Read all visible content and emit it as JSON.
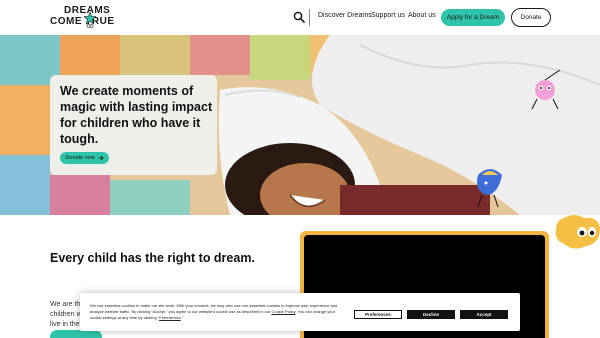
{
  "header": {
    "logo_line1": "DREAMS",
    "logo_line2": "COME TRUE",
    "nav": [
      "Discover Dreams",
      "Support us",
      "About us"
    ],
    "apply_label": "Apply for a Dream",
    "donate_label": "Donate"
  },
  "hero": {
    "heading": "We create moments of magic with lasting impact for children who have it tough.",
    "button_label": "Donate now"
  },
  "section": {
    "title": "Every child has the right to dream.",
    "text_lines": [
      "We are the",
      "children wi",
      "live in the h"
    ]
  },
  "cookie": {
    "text_before_policy": "We use essential cookies to make our site work. With your consent, we may also use non-essential cookies to improve user experience and analyze website traffic. By clicking “Accept,” you agree to our website's cookie use as described in our ",
    "policy_link": "Cookie Policy",
    "text_after_policy": ". You can change your cookie settings at any time by clicking “",
    "preferences_link": "Preferences",
    "text_end": ".”",
    "preferences_label": "Preferences",
    "decline_label": "Decline",
    "accept_label": "Accept"
  },
  "colors": {
    "accent": "#2ec4a9",
    "video_border": "#f3b341"
  },
  "icons": [
    "search-icon",
    "arrow-right-icon",
    "star-logo-icon"
  ]
}
